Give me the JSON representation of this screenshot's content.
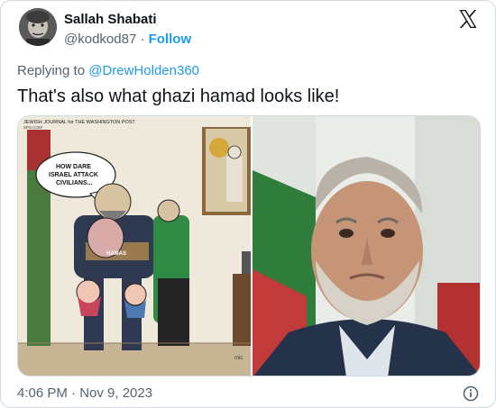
{
  "tweet": {
    "author_name": "Sallah Shabati",
    "author_handle": "@kodkod87",
    "separator": "·",
    "follow_label": "Follow",
    "replying_prefix": "Replying to",
    "replying_to": "@DrewHolden360",
    "text": "That's also what ghazi hamad looks like!",
    "timestamp": "4:06 PM · Nov 9, 2023"
  },
  "media": {
    "left_image": {
      "description_kind": "editorial-cartoon",
      "header_text": "JEWISH JOURNAL for THE WASHINGTON POST",
      "header_sub": "SPS.COM",
      "bubble_text": [
        "HOW DARE",
        "ISRAEL ATTACK",
        "CIVILIANS..."
      ],
      "belt_text": "HAMAS",
      "signature": "mic"
    },
    "right_image": {
      "description_kind": "portrait-photo"
    }
  },
  "icons": {
    "brand": "x-logo-icon",
    "info": "info-icon"
  },
  "colors": {
    "link": "#1d9bf0",
    "secondary_text": "#536471",
    "primary_text": "#0f1419",
    "border": "#cfd9de"
  }
}
